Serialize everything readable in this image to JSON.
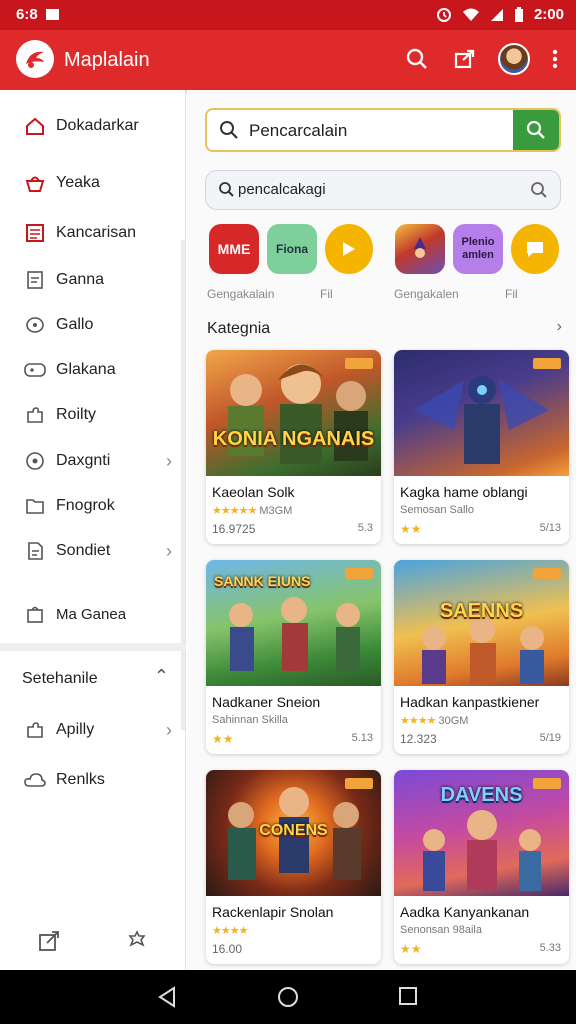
{
  "status": {
    "left": "6:8",
    "time": "2:00"
  },
  "appbar": {
    "title": "Maplalain"
  },
  "drawer": {
    "items": [
      {
        "label": "Dokadarkar",
        "icon": "home-icon",
        "chevron": false
      },
      {
        "label": "Yeaka",
        "icon": "basket-icon",
        "chevron": false
      },
      {
        "label": "Kancarisan",
        "icon": "list-icon",
        "chevron": false
      },
      {
        "label": "Ganna",
        "icon": "note-icon",
        "chevron": false
      },
      {
        "label": "Gallo",
        "icon": "chat-icon",
        "chevron": false
      },
      {
        "label": "Glakana",
        "icon": "gamepad-icon",
        "chevron": false
      },
      {
        "label": "Roilty",
        "icon": "puzzle-icon",
        "chevron": false
      },
      {
        "label": "Daxgnti",
        "icon": "target-icon",
        "chevron": true
      },
      {
        "label": "Fnogrok",
        "icon": "folder-icon",
        "chevron": false
      },
      {
        "label": "Sondiet",
        "icon": "doc-icon",
        "chevron": true
      },
      {
        "label": "Ma Ganea",
        "icon": "bag-icon",
        "chevron": false
      }
    ],
    "section": "Setehanile",
    "section_items": [
      {
        "label": "Apilly",
        "icon": "puzzle-icon",
        "chevron": true
      },
      {
        "label": "Renlks",
        "icon": "cloud-icon",
        "chevron": false
      }
    ]
  },
  "search": {
    "main_value": "Pencarcalain",
    "secondary_value": "pencalcakagi"
  },
  "chips": [
    {
      "label": "MME",
      "bg": "#d62828"
    },
    {
      "label": "Fiona",
      "bg": "#7ecf9a"
    },
    {
      "label": "",
      "bg": "#f4b400"
    },
    {
      "label": "",
      "bg": "#6a4fb3"
    },
    {
      "label": "Plenio amlen",
      "bg": "#b57ee8"
    },
    {
      "label": "",
      "bg": "#f4b400"
    }
  ],
  "chip_captions": [
    "Gengakalain",
    "Fil",
    "Gengakalen",
    "Fil"
  ],
  "categories": {
    "title": "Kategnia"
  },
  "cards": [
    {
      "title": "Kaeolan Solk",
      "rating_text": "M3GM",
      "meta": "16.9725",
      "meta_right": "5.3",
      "art_text": "KONIA NGANAIS",
      "art_bg": "linear-gradient(160deg,#f2a64a 0%,#c0572a 40%,#3d6e2e 75%,#2a3d1c 100%)"
    },
    {
      "title": "Kagka hame oblangi",
      "rating_text": "Semosan Sallo",
      "meta": "",
      "meta_right": "5/13",
      "art_text": "",
      "art_bg": "linear-gradient(160deg,#2c2c6e 0%,#4a3c8c 40%,#c9672e 85%,#f5a03a 100%)"
    },
    {
      "title": "Nadkaner Sneion",
      "rating_text": "Sahinnan Skilla",
      "meta": "",
      "meta_right": "5.13",
      "art_text": "SANNK EIUNS",
      "art_bg": "linear-gradient(170deg,#6fb6e8 0%,#86c46a 45%,#3d8a3a 75%,#2a5a25 100%)"
    },
    {
      "title": "Hadkan kanpastkiener",
      "rating_text": "30GM",
      "meta": "12.323",
      "meta_right": "5/19",
      "art_text": "SAENNS",
      "art_bg": "linear-gradient(170deg,#4aa3e0 0%,#f0c050 50%,#e07a2c 80%,#8a3a22 100%)"
    },
    {
      "title": "Rackenlapir Snolan",
      "rating_text": "",
      "meta": "16.00",
      "meta_right": "",
      "art_text": "CONENS",
      "art_bg": "radial-gradient(circle at 50% 45%,#ffb640 0%,#e06a20 30%,#7a2a18 60%,#2a1a14 100%)"
    },
    {
      "title": "Aadka Kanyankanan",
      "rating_text": "Senonsan 98aila",
      "meta": "",
      "meta_right": "5.33",
      "art_text": "DAVENS",
      "art_bg": "linear-gradient(170deg,#7a4ad8 0%,#c54aa0 45%,#e06a5a 75%,#4a2a6a 100%)"
    }
  ],
  "colors": {
    "brand": "#de2a2a",
    "accent_green": "#3a9b3e",
    "star": "#f0b323"
  }
}
